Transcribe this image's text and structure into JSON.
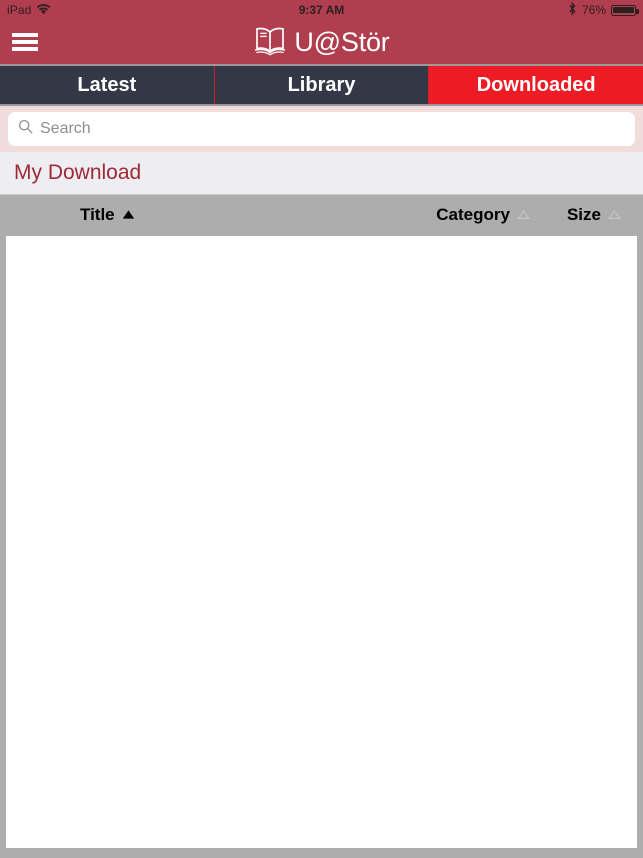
{
  "status_bar": {
    "device": "iPad",
    "wifi_icon": "wifi-icon",
    "time": "9:37 AM",
    "bluetooth_icon": "bluetooth-icon",
    "battery_percent": "76%",
    "battery_icon": "battery-full-icon"
  },
  "nav_bar": {
    "menu_icon": "hamburger-menu-icon",
    "logo_icon": "open-book-icon",
    "brand_title": "U@Stör",
    "background_color": "#b03e4e"
  },
  "tabs": [
    {
      "label": "Latest",
      "active": false
    },
    {
      "label": "Library",
      "active": false
    },
    {
      "label": "Downloaded",
      "active": true
    }
  ],
  "tab_colors": {
    "inactive_background": "#343846",
    "active_background": "#ed1c24",
    "divider": "#cf2027",
    "text": "#ffffff"
  },
  "search": {
    "icon": "search-icon",
    "placeholder": "Search",
    "value": "",
    "bar_background": "#f0dcdb"
  },
  "section": {
    "title": "My Download",
    "title_color": "#9e2a35",
    "background": "#eeedf2"
  },
  "table": {
    "header_background": "#adadad",
    "columns": [
      {
        "label": "Title",
        "sort": "ascending",
        "sort_icon": "triangle-up-filled-icon"
      },
      {
        "label": "Category",
        "sort": "none",
        "sort_icon": "triangle-up-outline-icon"
      },
      {
        "label": "Size",
        "sort": "none",
        "sort_icon": "triangle-up-outline-icon"
      }
    ],
    "rows": [],
    "empty": true
  }
}
